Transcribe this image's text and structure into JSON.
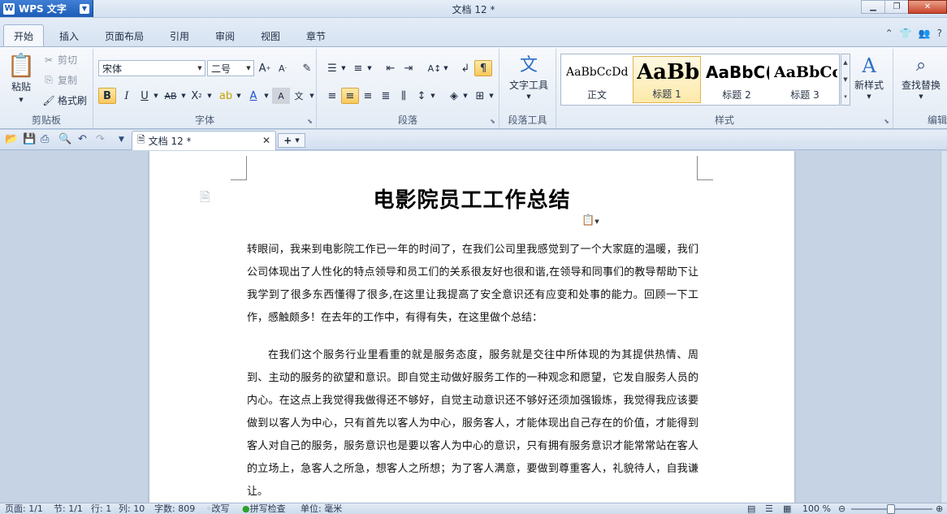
{
  "app": {
    "name": "WPS 文字",
    "window_title": "文档 12 *"
  },
  "menu": {
    "tabs": [
      "开始",
      "插入",
      "页面布局",
      "引用",
      "审阅",
      "视图",
      "章节"
    ]
  },
  "ribbon": {
    "clipboard": {
      "paste": "粘贴",
      "cut": "剪切",
      "copy": "复制",
      "format_painter": "格式刷",
      "label": "剪贴板"
    },
    "font": {
      "name": "宋体",
      "size": "二号",
      "label": "字体"
    },
    "paragraph": {
      "label": "段落"
    },
    "paragraph_tools": {
      "button": "文字工具",
      "label": "段落工具"
    },
    "styles": {
      "items": [
        {
          "sample": "AaBbCcDd",
          "name": "正文"
        },
        {
          "sample": "AaBb(",
          "name": "标题 1"
        },
        {
          "sample": "AaBbC(",
          "name": "标题 2"
        },
        {
          "sample": "AaBbCc",
          "name": "标题 3"
        }
      ],
      "new_style": "新样式",
      "label": "样式"
    },
    "edit": {
      "find_replace": "查找替换",
      "label": "编辑"
    }
  },
  "doc_tab": {
    "title": "文档 12 *"
  },
  "document": {
    "title": "电影院员工工作总结",
    "paragraphs": [
      "转眼间，我来到电影院工作已一年的时间了，在我们公司里我感觉到了一个大家庭的温暖，我们公司体现出了人性化的特点领导和员工们的关系很友好也很和谐,在领导和同事们的教导帮助下让我学到了很多东西懂得了很多,在这里让我提高了安全意识还有应变和处事的能力。回顾一下工作，感触颇多！在去年的工作中，有得有失，在这里做个总结：",
      "在我们这个服务行业里看重的就是服务态度，服务就是交往中所体现的为其提供热情、周到、主动的服务的欲望和意识。即自觉主动做好服务工作的一种观念和愿望，它发自服务人员的内心。在这点上我觉得我做得还不够好，自觉主动意识还不够好还须加强锻炼，我觉得我应该要做到以客人为中心，只有首先以客人为中心，服务客人，才能体现出自己存在的价值，才能得到客人对自己的服务，服务意识也是要以客人为中心的意识，只有拥有服务意识才能常常站在客人的立场上，急客人之所急，想客人之所想；为了客人满意，要做到尊重客人，礼貌待人，自我谦让。"
    ]
  },
  "status": {
    "page": "页面: 1/1",
    "section": "节: 1/1",
    "line": "行: 1",
    "column": "列: 10",
    "words": "字数: 809",
    "revise": "改写",
    "spell": "拼写检查",
    "unit": "单位: 毫米",
    "zoom": "100 %"
  }
}
